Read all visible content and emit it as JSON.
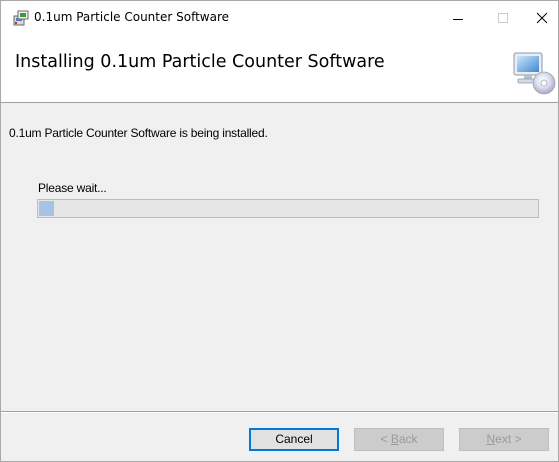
{
  "window": {
    "title": "0.1um Particle Counter Software",
    "controls": {
      "minimize_icon": "minimize-icon",
      "maximize_icon": "maximize-icon",
      "close_icon": "close-icon"
    }
  },
  "banner": {
    "title": "Installing 0.1um Particle Counter Software",
    "graphic_icon": "computer-cd-icon"
  },
  "body": {
    "status_text": "0.1um Particle Counter Software is being installed.",
    "wait_label": "Please wait...",
    "progress_fraction": 0.03
  },
  "buttons": {
    "cancel_label": "Cancel",
    "back_underline": "B",
    "back_rest": "ack",
    "back_suffix": " <",
    "back_prefix": "< ",
    "next_underline": "N",
    "next_rest": "ext",
    "next_suffix": " >",
    "back_enabled": false,
    "next_enabled": false
  },
  "colors": {
    "progress_fill": "#a6c3e3",
    "focus_border": "#0078d7"
  }
}
